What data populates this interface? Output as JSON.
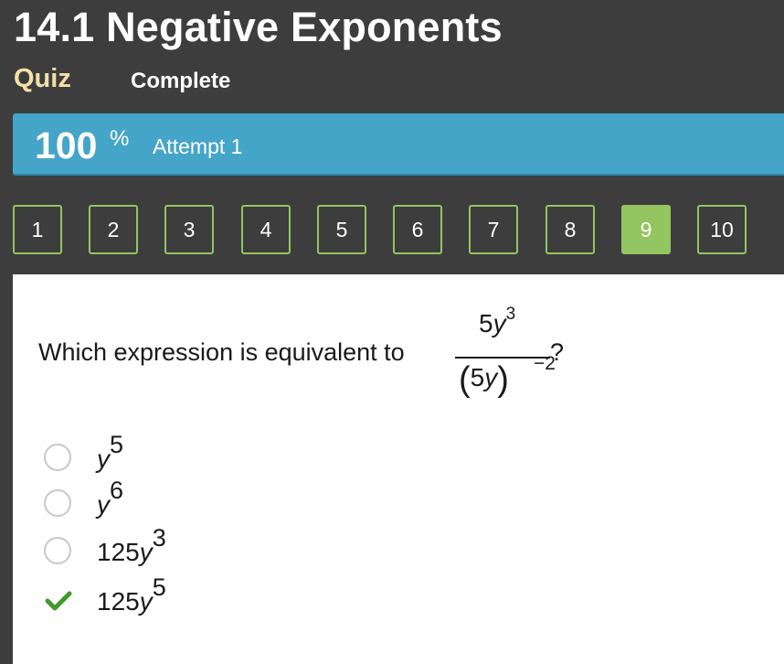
{
  "header": {
    "title": "14.1 Negative Exponents",
    "quiz_label": "Quiz",
    "status": "Complete"
  },
  "score": {
    "value": "100",
    "unit": "%",
    "attempt": "Attempt 1"
  },
  "question_nav": {
    "items": [
      "1",
      "2",
      "3",
      "4",
      "5",
      "6",
      "7",
      "8",
      "9",
      "10"
    ],
    "current": "9"
  },
  "question": {
    "prompt": "Which expression is equivalent to",
    "numerator_coef": "5",
    "numerator_var": "y",
    "numerator_exp": "3",
    "denominator_open": "(",
    "denominator_coef": "5",
    "denominator_var": "y",
    "denominator_close": ")",
    "denominator_exp": "−2",
    "end_mark": "?"
  },
  "options": [
    {
      "coef": "",
      "var": "y",
      "exp": "5",
      "selected": false
    },
    {
      "coef": "",
      "var": "y",
      "exp": "6",
      "selected": false
    },
    {
      "coef": "125",
      "var": "y",
      "exp": "3",
      "selected": false
    },
    {
      "coef": "125",
      "var": "y",
      "exp": "5",
      "selected": true
    }
  ],
  "colors": {
    "background": "#3d3d3d",
    "banner": "#45a5c9",
    "accent_green": "#93c560",
    "quiz_label": "#f3dfa8",
    "check": "#3f9a2b"
  }
}
